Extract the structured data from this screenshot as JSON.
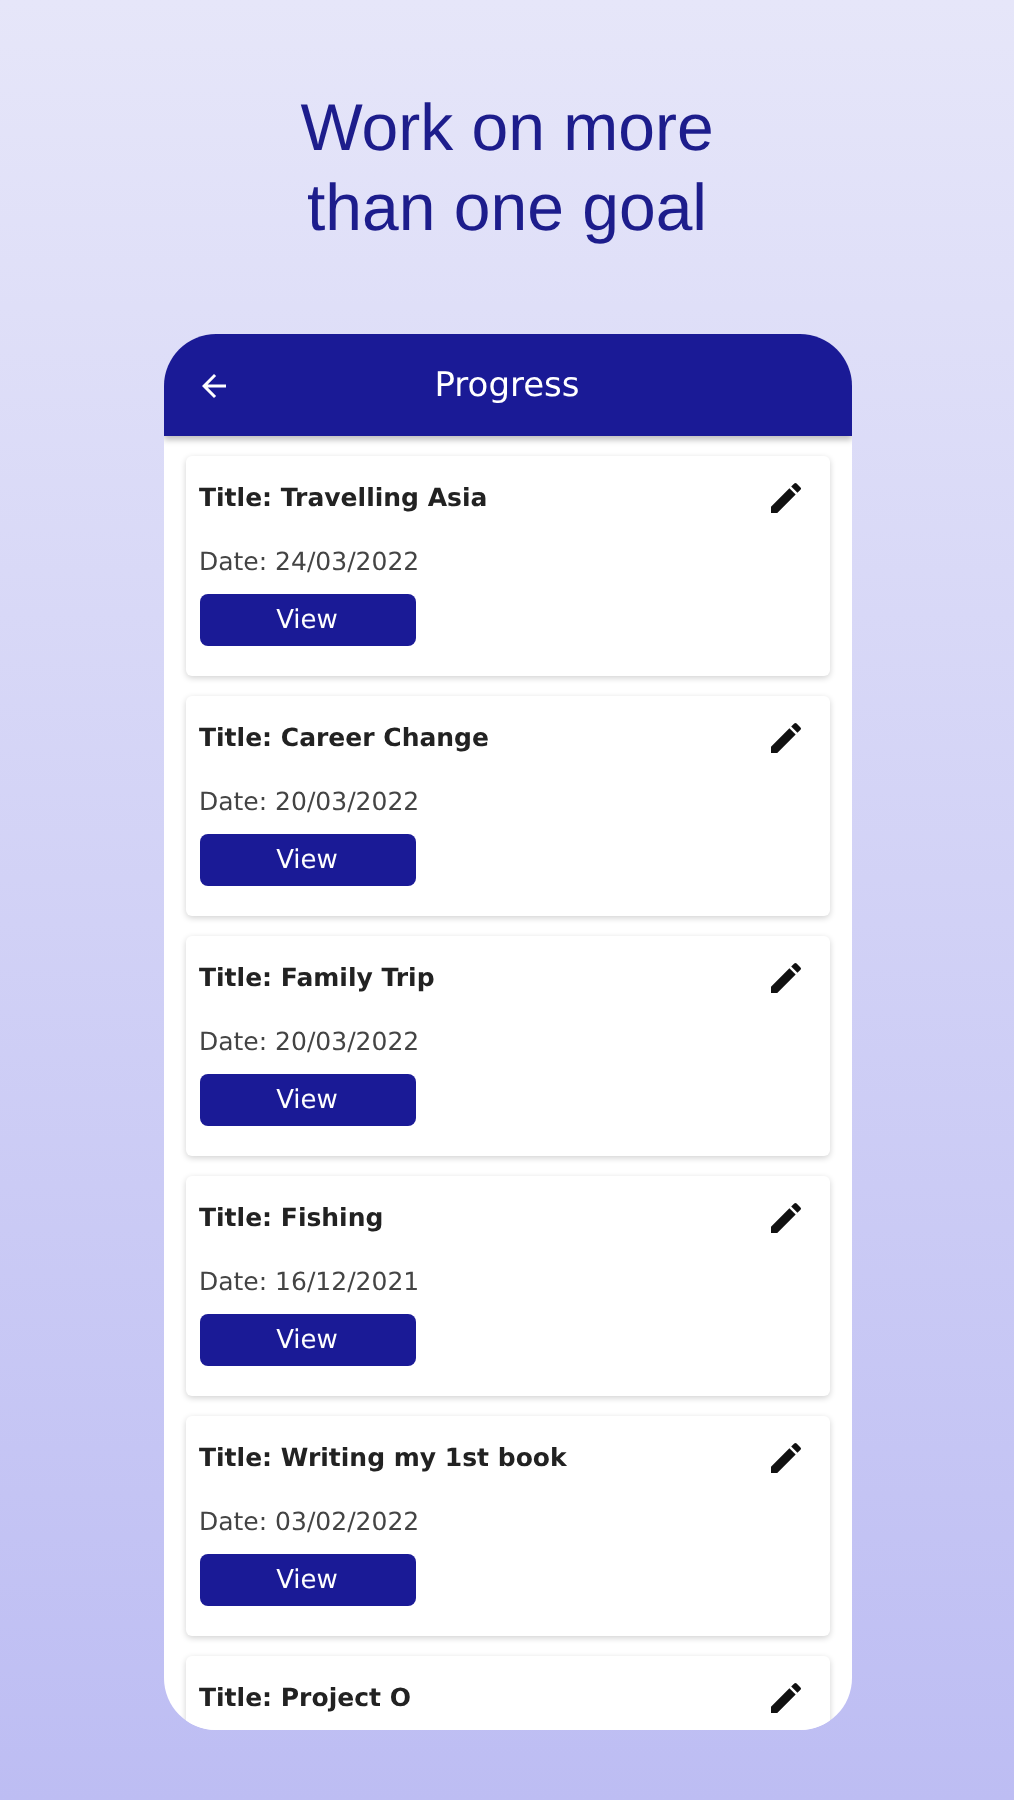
{
  "headline": "Work on more than one goal",
  "app_bar": {
    "title": "Progress"
  },
  "goals": [
    {
      "title": "Title: Travelling Asia",
      "date": "Date: 24/03/2022",
      "button": "View"
    },
    {
      "title": "Title: Career Change",
      "date": "Date: 20/03/2022",
      "button": "View"
    },
    {
      "title": "Title: Family Trip",
      "date": "Date: 20/03/2022",
      "button": "View"
    },
    {
      "title": "Title: Fishing",
      "date": "Date: 16/12/2021",
      "button": "View"
    },
    {
      "title": "Title: Writing my 1st book",
      "date": "Date: 03/02/2022",
      "button": "View"
    },
    {
      "title": "Title: Project O"
    }
  ]
}
